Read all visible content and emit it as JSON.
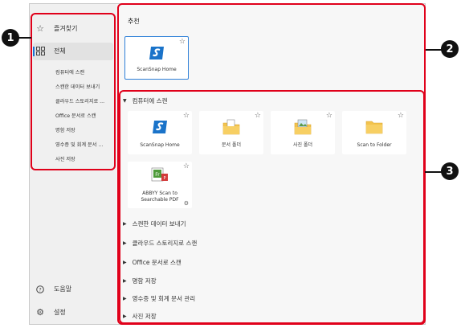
{
  "sidebar": {
    "favorites_label": "즐겨찾기",
    "all_label": "전체",
    "sub_items": [
      "컴퓨터에 스캔",
      "스캔한 데이터 보내기",
      "클라우드 스토리지로 ...",
      "Office 문서로 스캔",
      "명함 저장",
      "영수증 및 회계 문서 ...",
      "사진 저장"
    ],
    "help_label": "도움말",
    "settings_label": "설정"
  },
  "main": {
    "recommended_title": "추천",
    "recommended_card": "ScanSnap Home",
    "scan_to_computer_title": "컴퓨터에 스캔",
    "cards": [
      "ScanSnap Home",
      "문서 폴더",
      "사진 폴더",
      "Scan to Folder"
    ],
    "abbyy_line1": "ABBYY Scan to",
    "abbyy_line2": "Searchable PDF",
    "collapsed_sections": [
      "스캔한 데이터 보내기",
      "클라우드 스토리지로 스캔",
      "Office 문서로 스캔",
      "명함 저장",
      "영수증 및 회계 문서 관리",
      "사진 저장"
    ]
  },
  "callouts": [
    "1",
    "2",
    "3"
  ],
  "colors": {
    "callout_red": "#e0001a",
    "selection_blue": "#2e80d8",
    "folder_yellow": "#f3c34d",
    "scansnap_blue": "#1a73c9"
  }
}
